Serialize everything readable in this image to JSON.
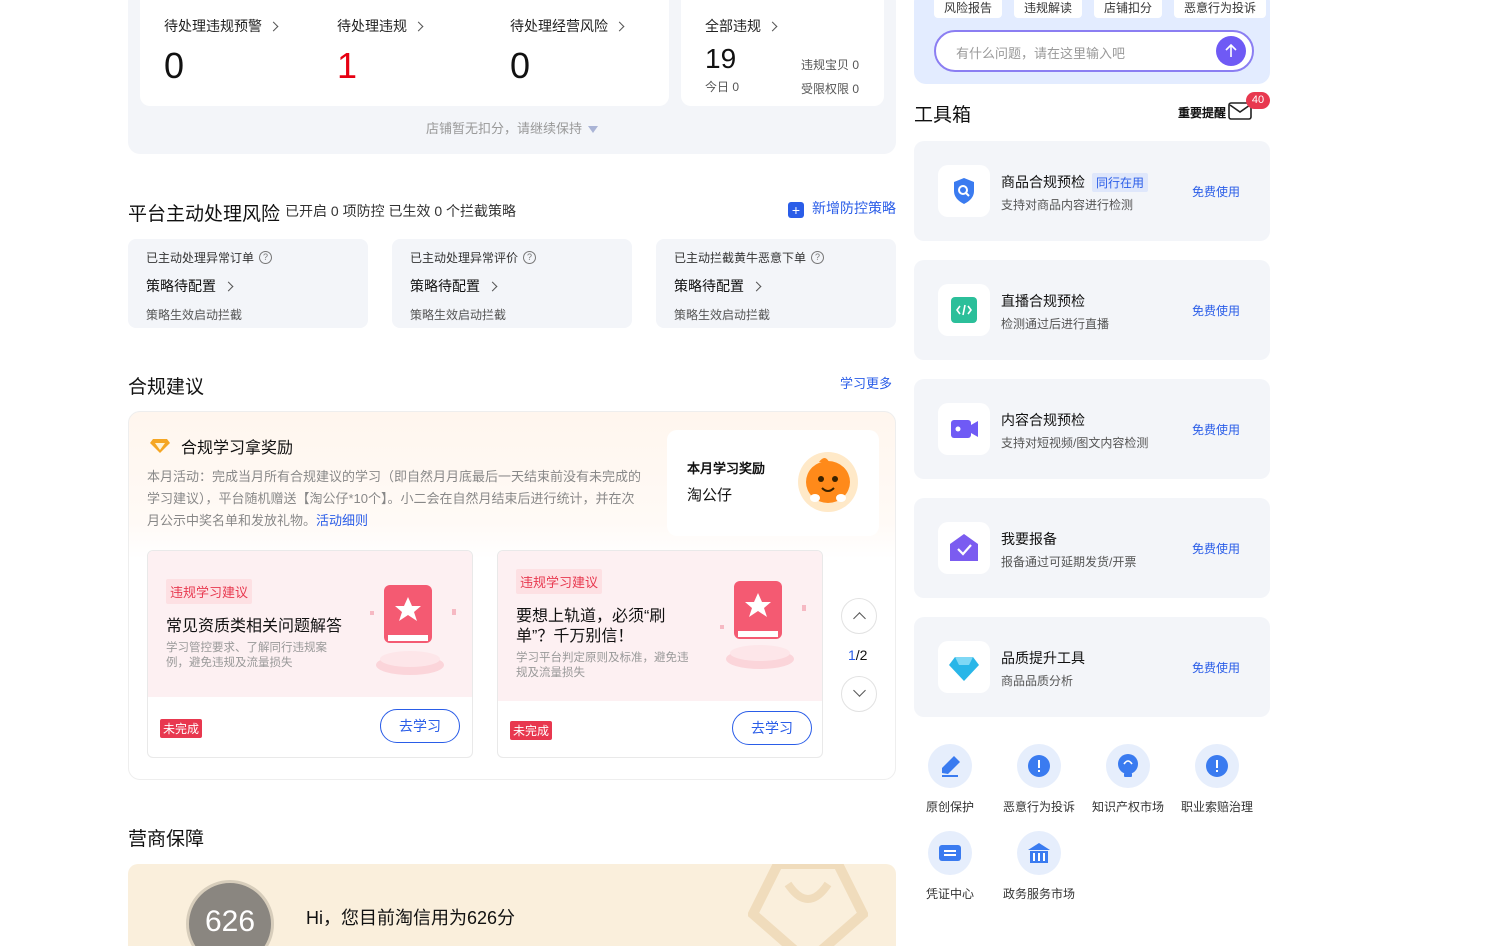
{
  "stats": {
    "items": [
      {
        "label": "待处理违规预警",
        "value": "0"
      },
      {
        "label": "待处理违规",
        "value": "1"
      },
      {
        "label": "待处理经营风险",
        "value": "0"
      }
    ],
    "all": {
      "label": "全部违规",
      "value": "19",
      "today": "今日 0",
      "baobei": "违规宝贝 0",
      "limited": "受限权限 0"
    },
    "note": "店铺暂无扣分，请继续保持"
  },
  "risk": {
    "title": "平台主动处理风险",
    "subtitle": "已开启 0 项防控 已生效 0 个拦截策略",
    "add_label": "新增防控策略",
    "cards": [
      {
        "title": "已主动处理异常订单",
        "status": "策略待配置",
        "desc": "策略生效启动拦截"
      },
      {
        "title": "已主动处理异常评价",
        "status": "策略待配置",
        "desc": "策略生效启动拦截"
      },
      {
        "title": "已主动拦截黄牛恶意下单",
        "status": "策略待配置",
        "desc": "策略生效启动拦截"
      }
    ]
  },
  "compliance": {
    "title": "合规建议",
    "more": "学习更多",
    "reward_title": "合规学习拿奖励",
    "reward_text": "本月活动：完成当月所有合规建议的学习（即自然月月底最后一天结束前没有未完成的学习建议），平台随机赠送【淘公仔*10个】。小二会在自然月结束后进行统计，并在次月公示中奖名单和发放礼物。",
    "reward_link": "活动细则",
    "reward_box_title": "本月学习奖励",
    "reward_box_name": "淘公仔",
    "cards": [
      {
        "tag": "违规学习建议",
        "title": "常见资质类相关问题解答",
        "desc": "学习管控要求、了解同行违规案例，避免违规及流量损失",
        "status": "未完成",
        "button": "去学习"
      },
      {
        "tag": "违规学习建议",
        "title": "要想上轨道，必须“刷单”？千万别信！",
        "desc": "学习平台判定原则及标准，避免违规及流量损失",
        "status": "未完成",
        "button": "去学习"
      }
    ],
    "pager_current": "1",
    "pager_total": "/2"
  },
  "guarantee": {
    "title": "营商保障",
    "score": "626",
    "text": "Hi，您目前淘信用为626分"
  },
  "assistant": {
    "chips": [
      "风险报告",
      "违规解读",
      "店铺扣分",
      "恶意行为投诉"
    ],
    "placeholder": "有什么问题，请在这里输入吧"
  },
  "toolbox": {
    "title": "工具箱",
    "remind": "重要提醒",
    "remind_count": "40",
    "tools": [
      {
        "name": "商品合规预检",
        "tag": "同行在用",
        "desc": "支持对商品内容进行检测",
        "action": "免费使用",
        "icon": "shield-search-icon",
        "color": "#3a7bf0"
      },
      {
        "name": "直播合规预检",
        "tag": "",
        "desc": "检测通过后进行直播",
        "action": "免费使用",
        "icon": "code-icon",
        "color": "#2bbf9a"
      },
      {
        "name": "内容合规预检",
        "tag": "",
        "desc": "支持对短视频/图文内容检测",
        "action": "免费使用",
        "icon": "video-icon",
        "color": "#6f5af5"
      },
      {
        "name": "我要报备",
        "tag": "",
        "desc": "报备通过可延期发货/开票",
        "action": "免费使用",
        "icon": "house-check-icon",
        "color": "#7b5cf0"
      },
      {
        "name": "品质提升工具",
        "tag": "",
        "desc": "商品品质分析",
        "action": "免费使用",
        "icon": "diamond-icon",
        "color": "#29b6e8"
      }
    ],
    "quick": [
      {
        "label": "原创保护",
        "icon": "pen-icon"
      },
      {
        "label": "恶意行为投诉",
        "icon": "alert-icon"
      },
      {
        "label": "知识产权市场",
        "icon": "bulb-icon"
      },
      {
        "label": "职业索赔治理",
        "icon": "alert-icon"
      },
      {
        "label": "凭证中心",
        "icon": "ticket-icon"
      },
      {
        "label": "政务服务市场",
        "icon": "bank-icon"
      }
    ]
  },
  "colors": {
    "accent": "#2a5de8",
    "danger": "#e60012",
    "tag_red": "#e8384f",
    "purple": "#6f5af5"
  }
}
